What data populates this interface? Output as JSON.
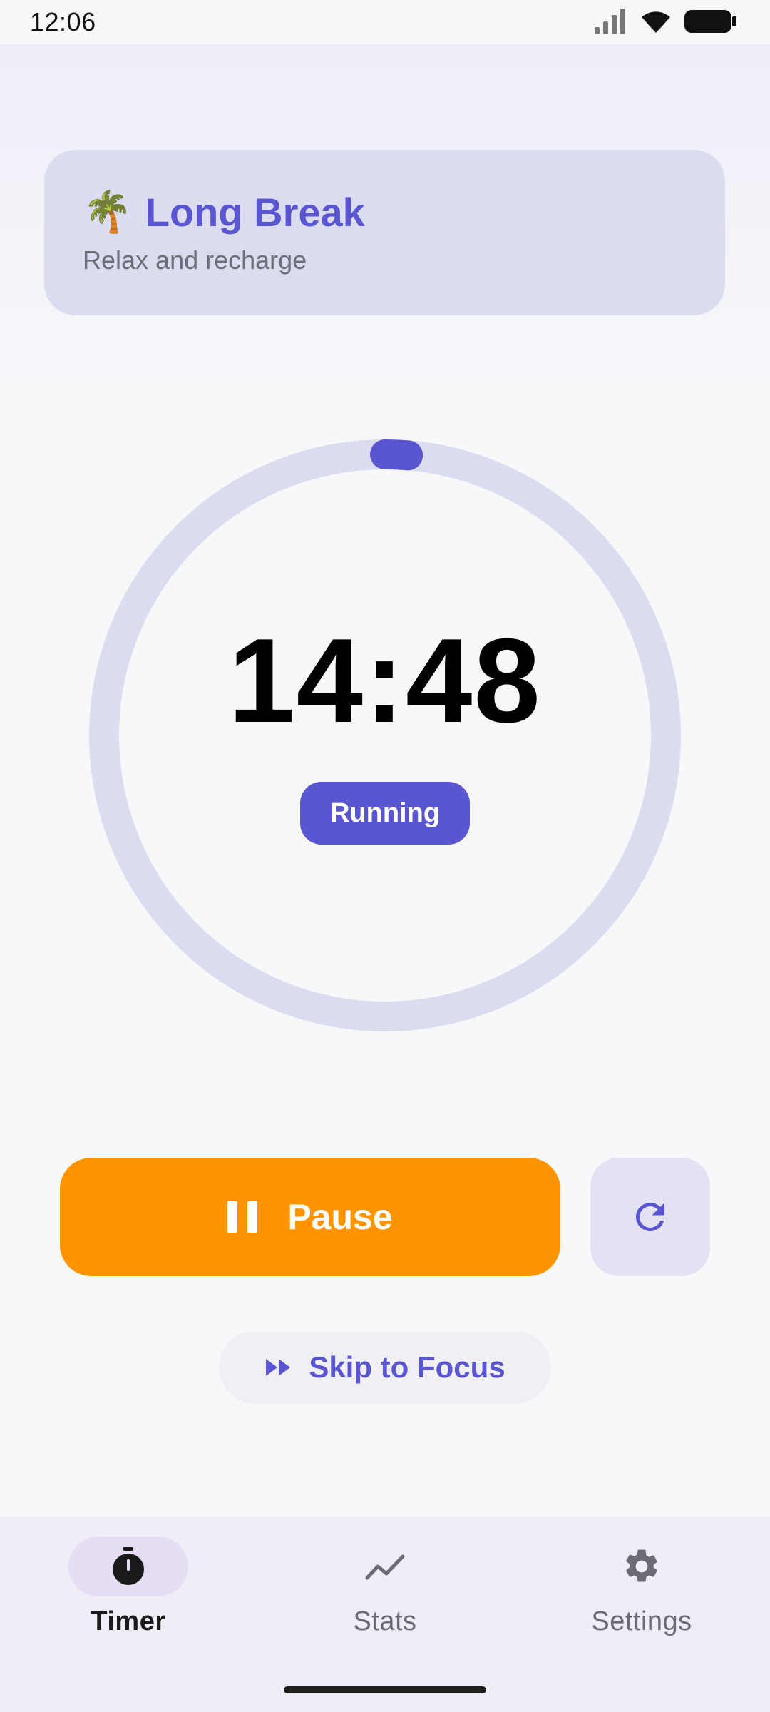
{
  "status_bar": {
    "time": "12:06"
  },
  "mode_card": {
    "emoji": "🌴",
    "title": "Long Break",
    "subtitle": "Relax and recharge"
  },
  "timer": {
    "time_remaining": "14:48",
    "state_label": "Running",
    "progress_fraction": 0.013
  },
  "controls": {
    "pause_label": "Pause",
    "skip_label": "Skip to Focus"
  },
  "nav": {
    "items": [
      {
        "label": "Timer",
        "icon": "timer-icon",
        "active": true
      },
      {
        "label": "Stats",
        "icon": "stats-icon",
        "active": false
      },
      {
        "label": "Settings",
        "icon": "settings-icon",
        "active": false
      }
    ]
  },
  "colors": {
    "accent": "#5A55D1",
    "pause_button": "#FF9400",
    "ring_track": "#DCDCF1",
    "card_background": "#DCDCF1"
  }
}
